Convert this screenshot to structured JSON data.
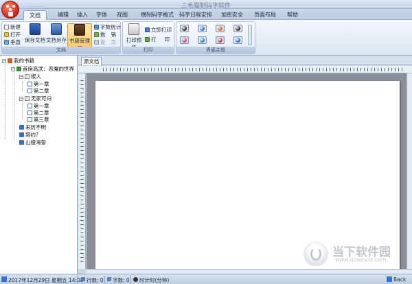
{
  "titlebar": {
    "title": "三毛猫制码字软件"
  },
  "menubar": {
    "tabs": [
      "文档",
      "编辑",
      "插入",
      "字体",
      "视图",
      "横制码字格式",
      "码字日程安排",
      "加密安全",
      "页面布局",
      "帮助"
    ]
  },
  "ribbon": {
    "doc_group": {
      "label": "文档",
      "new": "新建",
      "open": "打开",
      "page": "垂直",
      "save": "保存文档",
      "save_as": "文档另存",
      "book_manager": "书籍管理器",
      "word_count": "字数统计",
      "insert": "数",
      "insert2": "销",
      "small1": "壹",
      "small2": "页"
    },
    "print_group": {
      "label": "打印",
      "preview": "打印预览",
      "instant_print": "立即打印",
      "print": "打",
      "print2": "印"
    },
    "theme_group": {
      "label": "界面主题"
    },
    "theme_colors": [
      "#2b2b2b",
      "#3a6fd6",
      "#e05a1e",
      "#222222",
      "#c23f9a",
      "#2f83d8",
      "#c8325a",
      "#2b67c9"
    ]
  },
  "tree": {
    "root": "我的书籍",
    "book1": "首席高武：恶魔的世界",
    "vol1": "楔人",
    "ch1": "第一章",
    "ch2": "第二章",
    "vol2": "无家可归",
    "ch3": "第一章",
    "ch4": "第二章",
    "ch5": "第三章",
    "book2": "来历不明",
    "book3": "契约？",
    "book4": "山楂海誓"
  },
  "editor": {
    "tab": "源文档"
  },
  "statusbar": {
    "datetime": "2017年12月29日 星期五 14:08",
    "rows": "行数: 0",
    "chars": "字数: 0",
    "timer": "时计时(分钟)",
    "back": "Back"
  },
  "watermark": {
    "name": "当下软件园",
    "url": "www.downxia.com"
  }
}
